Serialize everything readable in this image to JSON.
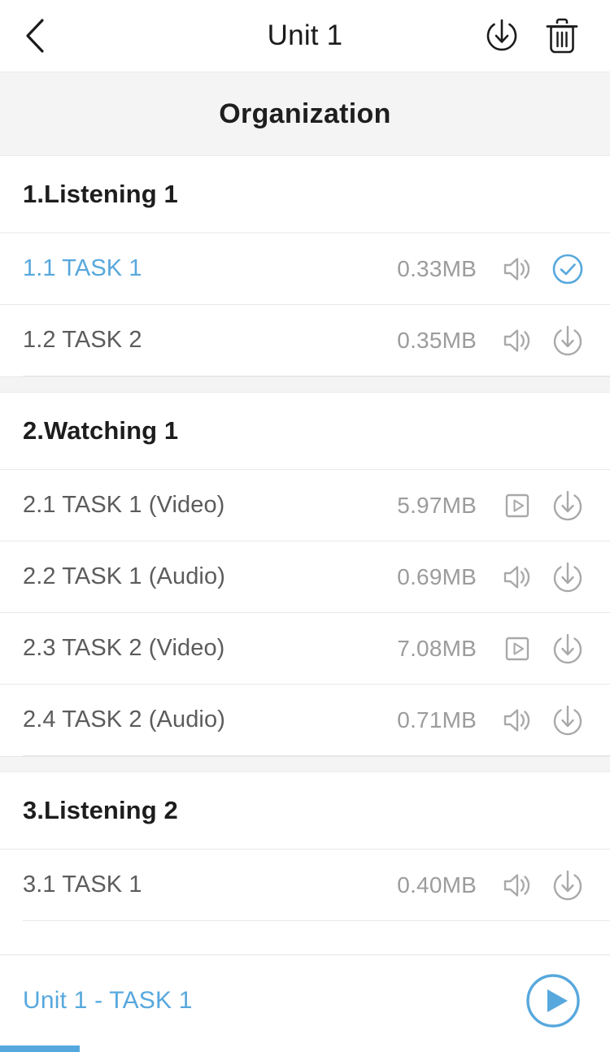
{
  "navbar": {
    "title": "Unit 1",
    "back_icon": "chevron-left-icon",
    "download_all_icon": "download-circle-icon",
    "delete_icon": "trash-icon"
  },
  "org_band": {
    "title": "Organization"
  },
  "colors": {
    "accent_blue": "#57a8dd",
    "text_dark": "#1d1d1d",
    "text_muted": "#5c5c5c",
    "text_size": "#9c9c9c",
    "band_gray": "#f4f4f4",
    "divider": "#e8e8e8"
  },
  "sections": [
    {
      "title": "1.Listening 1",
      "rows": [
        {
          "title": "1.1 TASK 1",
          "size": "0.33MB",
          "media_icon": "speaker-icon",
          "state_icon": "check-circle-icon",
          "active": true
        },
        {
          "title": "1.2 TASK 2",
          "size": "0.35MB",
          "media_icon": "speaker-icon",
          "state_icon": "download-circle-icon",
          "active": false
        }
      ]
    },
    {
      "title": "2.Watching 1",
      "rows": [
        {
          "title": "2.1 TASK 1 (Video)",
          "size": "5.97MB",
          "media_icon": "video-play-icon",
          "state_icon": "download-circle-icon",
          "active": false
        },
        {
          "title": "2.2 TASK 1 (Audio)",
          "size": "0.69MB",
          "media_icon": "speaker-icon",
          "state_icon": "download-circle-icon",
          "active": false
        },
        {
          "title": "2.3 TASK 2 (Video)",
          "size": "7.08MB",
          "media_icon": "video-play-icon",
          "state_icon": "download-circle-icon",
          "active": false
        },
        {
          "title": "2.4 TASK 2 (Audio)",
          "size": "0.71MB",
          "media_icon": "speaker-icon",
          "state_icon": "download-circle-icon",
          "active": false
        }
      ]
    },
    {
      "title": "3.Listening 2",
      "rows": [
        {
          "title": "3.1 TASK 1",
          "size": "0.40MB",
          "media_icon": "speaker-icon",
          "state_icon": "download-circle-icon",
          "active": false
        }
      ]
    }
  ],
  "player": {
    "now_playing": "Unit 1 - TASK 1",
    "play_icon": "play-circle-icon",
    "progress_percent": 13
  }
}
